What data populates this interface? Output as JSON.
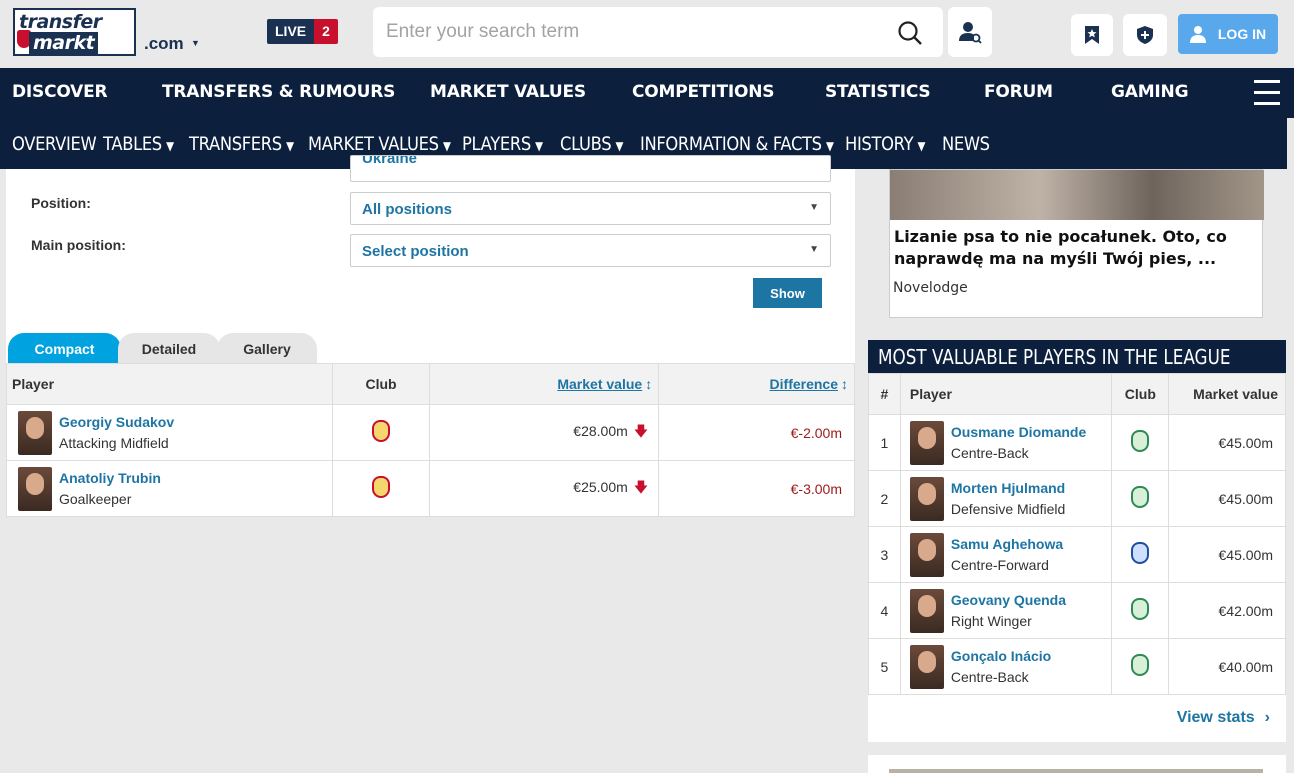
{
  "header": {
    "logo_line1": "transfer",
    "logo_line2": "markt",
    "domain": ".com",
    "live_label": "LIVE",
    "live_count": "2",
    "search_placeholder": "Enter your search term",
    "login_label": "LOG IN"
  },
  "main_nav": [
    "DISCOVER",
    "TRANSFERS & RUMOURS",
    "MARKET VALUES",
    "COMPETITIONS",
    "STATISTICS",
    "FORUM",
    "GAMING"
  ],
  "sub_nav": [
    {
      "label": "OVERVIEW",
      "caret": false
    },
    {
      "label": "TABLES",
      "caret": true
    },
    {
      "label": "TRANSFERS",
      "caret": true
    },
    {
      "label": "MARKET VALUES",
      "caret": true
    },
    {
      "label": "PLAYERS",
      "caret": true
    },
    {
      "label": "CLUBS",
      "caret": true
    },
    {
      "label": "INFORMATION & FACTS",
      "caret": true
    },
    {
      "label": "HISTORY",
      "caret": true
    },
    {
      "label": "NEWS",
      "caret": false
    }
  ],
  "filters": {
    "nationality_value": "Ukraine",
    "position_label": "Position:",
    "position_value": "All positions",
    "main_position_label": "Main position:",
    "main_position_value": "Select position",
    "show_button": "Show"
  },
  "view_tabs": [
    "Compact",
    "Detailed",
    "Gallery"
  ],
  "players_table": {
    "headers": {
      "player": "Player",
      "club": "Club",
      "market_value": "Market value",
      "difference": "Difference"
    },
    "rows": [
      {
        "name": "Georgiy Sudakov",
        "position": "Attacking Midfield",
        "club_icon": "benfica-badge-icon",
        "market_value": "€28.00m",
        "difference": "€-2.00m"
      },
      {
        "name": "Anatoliy Trubin",
        "position": "Goalkeeper",
        "club_icon": "benfica-badge-icon",
        "market_value": "€25.00m",
        "difference": "€-3.00m"
      }
    ]
  },
  "ad": {
    "title": "Lizanie psa to nie pocałunek. Oto, co naprawdę ma na myśli Twój pies, ...",
    "source": "Novelodge"
  },
  "most_valuable": {
    "title": "MOST VALUABLE PLAYERS IN THE LEAGUE",
    "headers": {
      "rank": "#",
      "player": "Player",
      "club": "Club",
      "market_value": "Market value"
    },
    "rows": [
      {
        "rank": "1",
        "name": "Ousmane Diomande",
        "position": "Centre-Back",
        "club_icon": "sporting-badge-icon",
        "market_value": "€45.00m"
      },
      {
        "rank": "2",
        "name": "Morten Hjulmand",
        "position": "Defensive Midfield",
        "club_icon": "sporting-badge-icon",
        "market_value": "€45.00m"
      },
      {
        "rank": "3",
        "name": "Samu Aghehowa",
        "position": "Centre-Forward",
        "club_icon": "porto-badge-icon",
        "market_value": "€45.00m"
      },
      {
        "rank": "4",
        "name": "Geovany Quenda",
        "position": "Right Winger",
        "club_icon": "sporting-badge-icon",
        "market_value": "€42.00m"
      },
      {
        "rank": "5",
        "name": "Gonçalo Inácio",
        "position": "Centre-Back",
        "club_icon": "sporting-badge-icon",
        "market_value": "€40.00m"
      }
    ],
    "view_stats": "View stats"
  }
}
